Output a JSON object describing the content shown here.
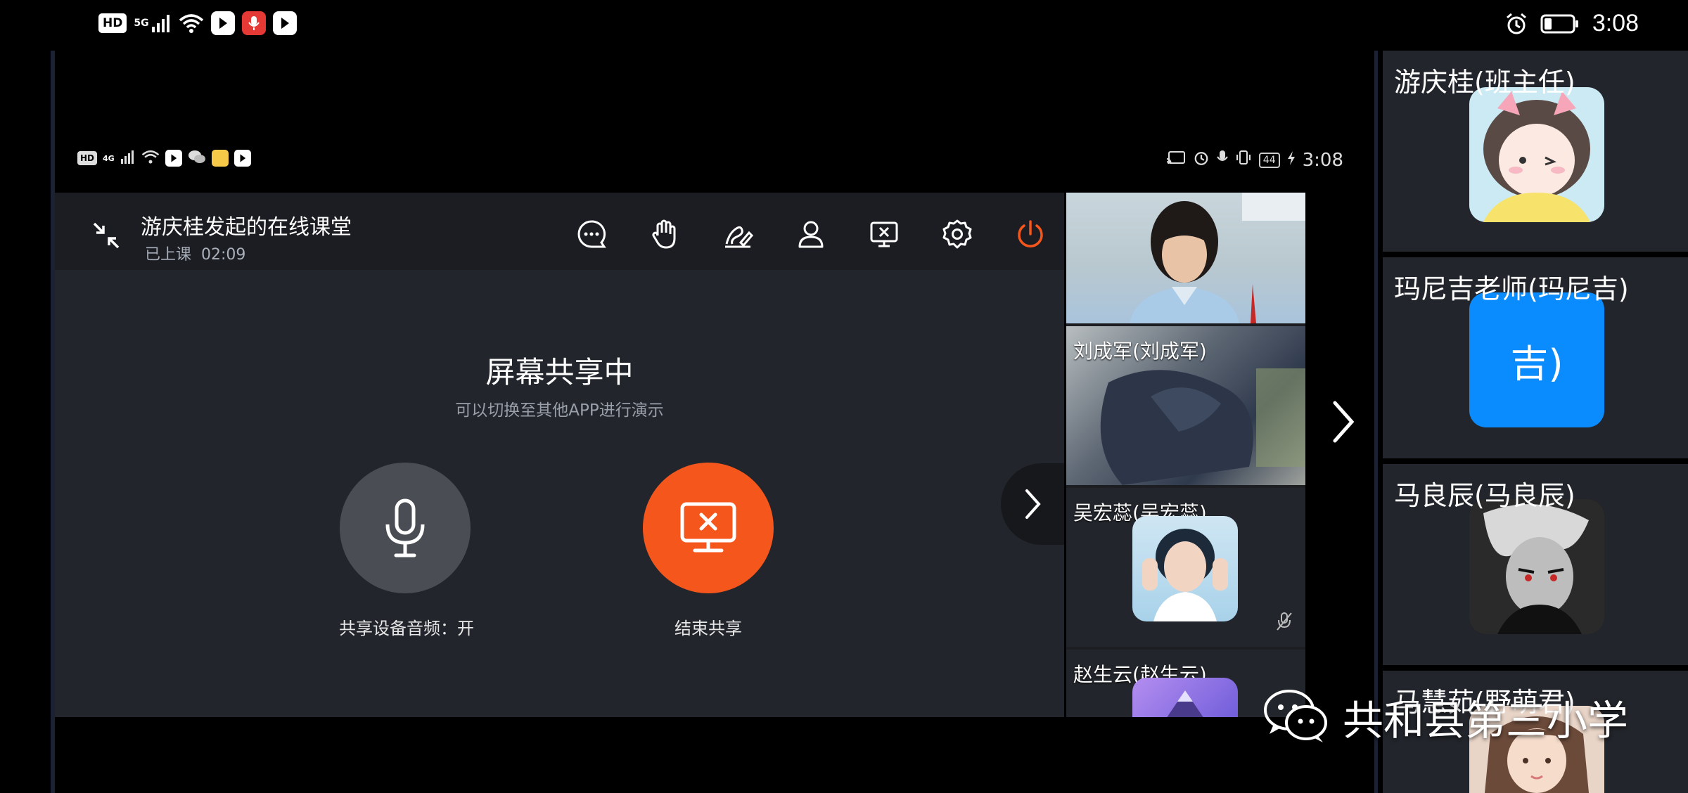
{
  "outer_status": {
    "hd": "HD",
    "network": "5G",
    "time": "3:08"
  },
  "inner_status": {
    "hd": "HD",
    "network": "4G",
    "battery": "44",
    "time": "3:08"
  },
  "meeting": {
    "title": "游庆桂发起的在线课堂",
    "status": "已上课  02:09",
    "toolbar": [
      {
        "icon": "chat-icon"
      },
      {
        "icon": "raise-hand-icon"
      },
      {
        "icon": "annotate-icon"
      },
      {
        "icon": "participants-icon"
      },
      {
        "icon": "stop-share-icon"
      },
      {
        "icon": "settings-icon"
      },
      {
        "icon": "power-icon"
      }
    ],
    "share_title": "屏幕共享中",
    "share_subtitle": "可以切换至其他APP进行演示",
    "audio_label": "共享设备音频：开",
    "end_label": "结束共享",
    "accent_color": "#f5561c"
  },
  "inner_videos": [
    {
      "name": ""
    },
    {
      "name": "刘成军(刘成军)"
    },
    {
      "name": "吴宏蕊(吴宏蕊)"
    },
    {
      "name": "赵生云(赵生云)"
    }
  ],
  "participants": [
    {
      "name": "游庆桂(班主任)",
      "avatar_type": "image"
    },
    {
      "name": "玛尼吉老师(玛尼吉)",
      "avatar_type": "text",
      "avatar_text": "吉)",
      "avatar_color": "#0a8cff"
    },
    {
      "name": "马良辰(马良辰)",
      "avatar_type": "image"
    },
    {
      "name": "马慧茹(野萌君)",
      "avatar_type": "image"
    }
  ],
  "watermark": {
    "text": "共和县第三小学"
  }
}
